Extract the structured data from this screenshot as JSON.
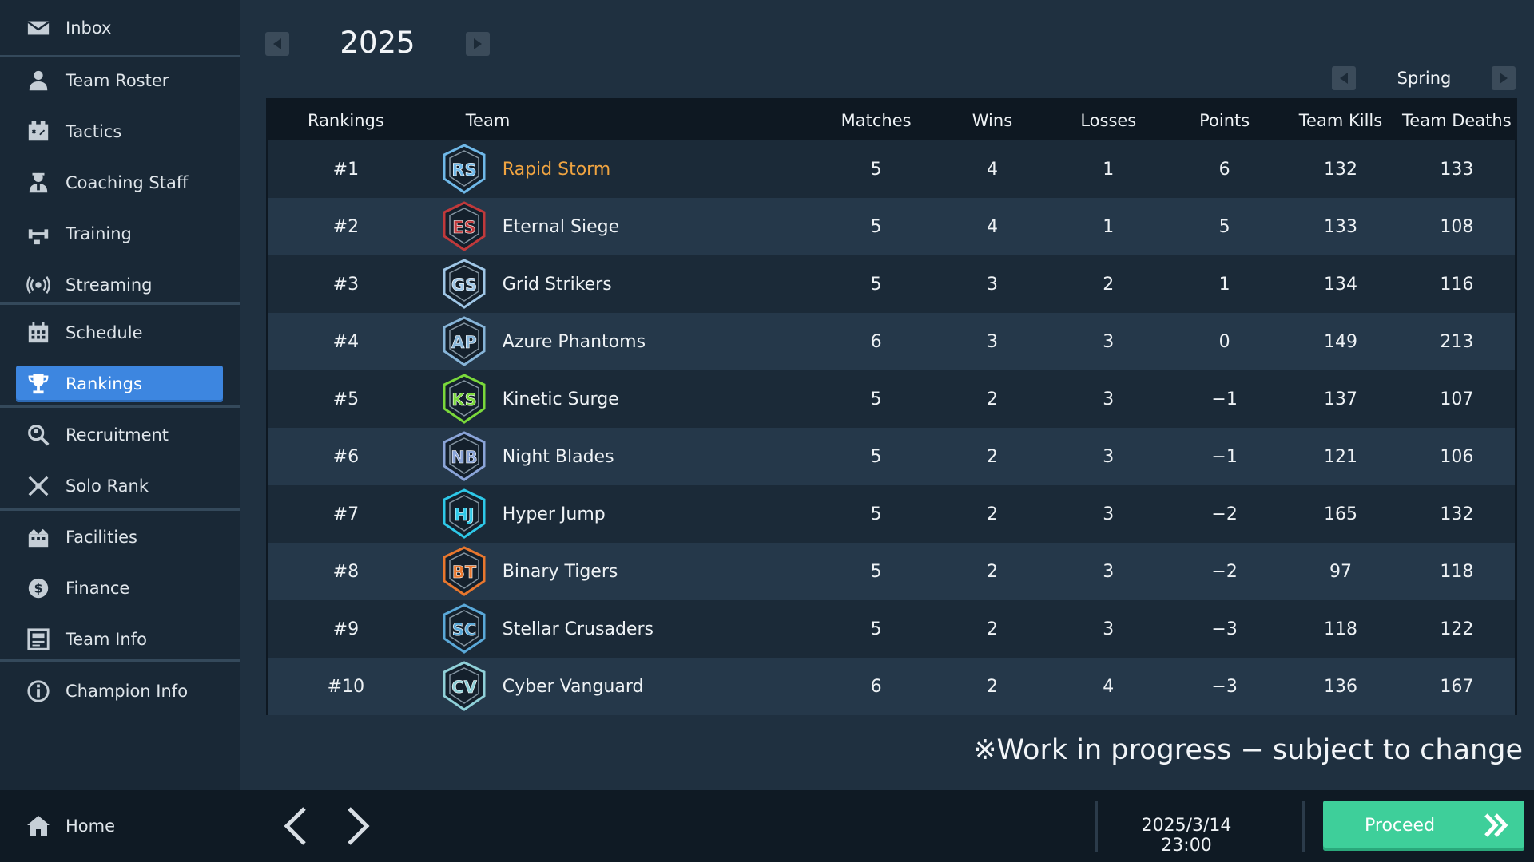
{
  "sidebar": {
    "items": [
      {
        "label": "Inbox",
        "icon": "mail-icon",
        "active": false
      },
      {
        "label": "Team Roster",
        "icon": "person-icon",
        "active": false
      },
      {
        "label": "Tactics",
        "icon": "tactics-board-icon",
        "active": false
      },
      {
        "label": "Coaching Staff",
        "icon": "coach-icon",
        "active": false
      },
      {
        "label": "Training",
        "icon": "dumbbell-icon",
        "active": false
      },
      {
        "label": "Streaming",
        "icon": "broadcast-icon",
        "active": false
      },
      {
        "label": "Schedule",
        "icon": "calendar-icon",
        "active": false
      },
      {
        "label": "Rankings",
        "icon": "trophy-icon",
        "active": true
      },
      {
        "label": "Recruitment",
        "icon": "magnifier-icon",
        "active": false
      },
      {
        "label": "Solo Rank",
        "icon": "crossed-swords-icon",
        "active": false
      },
      {
        "label": "Facilities",
        "icon": "facility-icon",
        "active": false
      },
      {
        "label": "Finance",
        "icon": "coin-icon",
        "active": false
      },
      {
        "label": "Team Info",
        "icon": "info-card-icon",
        "active": false
      },
      {
        "label": "Champion Info",
        "icon": "info-circle-icon",
        "active": false
      }
    ]
  },
  "header": {
    "year": "2025",
    "season": "Spring"
  },
  "table": {
    "columns": [
      "Rankings",
      "Team",
      "Matches",
      "Wins",
      "Losses",
      "Points",
      "Team Kills",
      "Team Deaths"
    ],
    "rows": [
      {
        "rank": "#1",
        "team": "Rapid Storm",
        "logo": "RS",
        "logo_color": "#6fb8e8",
        "highlight": true,
        "matches": "5",
        "wins": "4",
        "losses": "1",
        "points": "6",
        "kills": "132",
        "deaths": "133"
      },
      {
        "rank": "#2",
        "team": "Eternal Siege",
        "logo": "ES",
        "logo_color": "#c0393b",
        "highlight": false,
        "matches": "5",
        "wins": "4",
        "losses": "1",
        "points": "5",
        "kills": "133",
        "deaths": "108"
      },
      {
        "rank": "#3",
        "team": "Grid Strikers",
        "logo": "GS",
        "logo_color": "#9fc6e6",
        "highlight": false,
        "matches": "5",
        "wins": "3",
        "losses": "2",
        "points": "1",
        "kills": "134",
        "deaths": "116"
      },
      {
        "rank": "#4",
        "team": "Azure Phantoms",
        "logo": "AP",
        "logo_color": "#86b4d8",
        "highlight": false,
        "matches": "6",
        "wins": "3",
        "losses": "3",
        "points": "0",
        "kills": "149",
        "deaths": "213"
      },
      {
        "rank": "#5",
        "team": "Kinetic Surge",
        "logo": "KS",
        "logo_color": "#7ad83b",
        "highlight": false,
        "matches": "5",
        "wins": "2",
        "losses": "3",
        "points": "−1",
        "kills": "137",
        "deaths": "107"
      },
      {
        "rank": "#6",
        "team": "Night Blades",
        "logo": "NB",
        "logo_color": "#8aa4d8",
        "highlight": false,
        "matches": "5",
        "wins": "2",
        "losses": "3",
        "points": "−1",
        "kills": "121",
        "deaths": "106"
      },
      {
        "rank": "#7",
        "team": "Hyper Jump",
        "logo": "HJ",
        "logo_color": "#2ec8e8",
        "highlight": false,
        "matches": "5",
        "wins": "2",
        "losses": "3",
        "points": "−2",
        "kills": "165",
        "deaths": "132"
      },
      {
        "rank": "#8",
        "team": "Binary Tigers",
        "logo": "BT",
        "logo_color": "#e8772e",
        "highlight": false,
        "matches": "5",
        "wins": "2",
        "losses": "3",
        "points": "−2",
        "kills": "97",
        "deaths": "118"
      },
      {
        "rank": "#9",
        "team": "Stellar Crusaders",
        "logo": "SC",
        "logo_color": "#5aa8d8",
        "highlight": false,
        "matches": "5",
        "wins": "2",
        "losses": "3",
        "points": "−3",
        "kills": "118",
        "deaths": "122"
      },
      {
        "rank": "#10",
        "team": "Cyber Vanguard",
        "logo": "CV",
        "logo_color": "#8fd0d8",
        "highlight": false,
        "matches": "6",
        "wins": "2",
        "losses": "4",
        "points": "−3",
        "kills": "136",
        "deaths": "167"
      }
    ]
  },
  "notice": "※Work in progress − subject to change",
  "bottom": {
    "home_label": "Home",
    "datetime": "2025/3/14 23:00",
    "proceed_label": "Proceed"
  },
  "colors": {
    "accent": "#3d86e0",
    "proceed": "#3ecf9a",
    "highlight_team": "#f0a441"
  }
}
